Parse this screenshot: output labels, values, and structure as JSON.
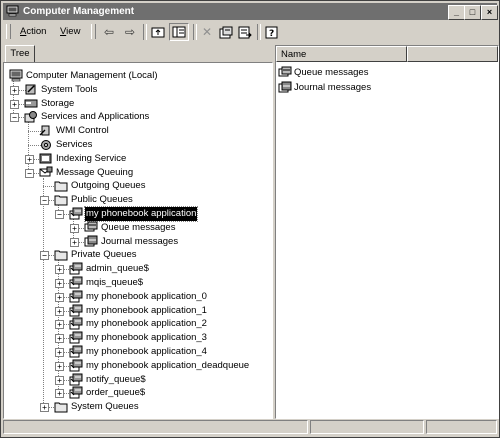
{
  "window": {
    "title": "Computer Management"
  },
  "titlebar_buttons": {
    "minimize": "_",
    "maximize": "□",
    "close": "×"
  },
  "menu": {
    "action": "Action",
    "view": "View"
  },
  "toolbar_icons": [
    "back-icon",
    "forward-icon",
    "up-folder-icon",
    "show-tree-icon",
    "delete-icon",
    "properties-icon",
    "export-icon",
    "help-icon"
  ],
  "tree_tab": "Tree",
  "list_header": {
    "name": "Name"
  },
  "tree": [
    {
      "label": "Computer Management (Local)",
      "icon": "computer-icon",
      "level": 0,
      "expander": "",
      "selected": false
    },
    {
      "label": "System Tools",
      "icon": "tools-icon",
      "level": 1,
      "expander": "+",
      "selected": false
    },
    {
      "label": "Storage",
      "icon": "storage-icon",
      "level": 1,
      "expander": "+",
      "selected": false
    },
    {
      "label": "Services and Applications",
      "icon": "services-apps-icon",
      "level": 1,
      "expander": "-",
      "selected": false
    },
    {
      "label": "WMI Control",
      "icon": "wmi-icon",
      "level": 2,
      "expander": "",
      "selected": false
    },
    {
      "label": "Services",
      "icon": "services-icon",
      "level": 2,
      "expander": "",
      "selected": false
    },
    {
      "label": "Indexing Service",
      "icon": "indexing-icon",
      "level": 2,
      "expander": "+",
      "selected": false
    },
    {
      "label": "Message Queuing",
      "icon": "message-queuing-icon",
      "level": 2,
      "expander": "-",
      "selected": false
    },
    {
      "label": "Outgoing Queues",
      "icon": "folder-icon",
      "level": 3,
      "expander": "",
      "selected": false
    },
    {
      "label": "Public Queues",
      "icon": "folder-icon",
      "level": 3,
      "expander": "-",
      "selected": false
    },
    {
      "label": "my phonebook application",
      "icon": "queue-icon",
      "level": 4,
      "expander": "-",
      "selected": true
    },
    {
      "label": "Queue messages",
      "icon": "queue-messages-icon",
      "level": 5,
      "expander": "+",
      "selected": false
    },
    {
      "label": "Journal messages",
      "icon": "journal-messages-icon",
      "level": 5,
      "expander": "+",
      "selected": false
    },
    {
      "label": "Private Queues",
      "icon": "folder-icon",
      "level": 3,
      "expander": "-",
      "selected": false
    },
    {
      "label": "admin_queue$",
      "icon": "queue-icon",
      "level": 4,
      "expander": "+",
      "selected": false
    },
    {
      "label": "mqis_queue$",
      "icon": "queue-icon",
      "level": 4,
      "expander": "+",
      "selected": false
    },
    {
      "label": "my phonebook application_0",
      "icon": "queue-icon",
      "level": 4,
      "expander": "+",
      "selected": false
    },
    {
      "label": "my phonebook application_1",
      "icon": "queue-icon",
      "level": 4,
      "expander": "+",
      "selected": false
    },
    {
      "label": "my phonebook application_2",
      "icon": "queue-icon",
      "level": 4,
      "expander": "+",
      "selected": false
    },
    {
      "label": "my phonebook application_3",
      "icon": "queue-icon",
      "level": 4,
      "expander": "+",
      "selected": false
    },
    {
      "label": "my phonebook application_4",
      "icon": "queue-icon",
      "level": 4,
      "expander": "+",
      "selected": false
    },
    {
      "label": "my phonebook application_deadqueue",
      "icon": "queue-icon",
      "level": 4,
      "expander": "+",
      "selected": false
    },
    {
      "label": "notify_queue$",
      "icon": "queue-icon",
      "level": 4,
      "expander": "+",
      "selected": false
    },
    {
      "label": "order_queue$",
      "icon": "queue-icon",
      "level": 4,
      "expander": "+",
      "selected": false
    },
    {
      "label": "System Queues",
      "icon": "folder-icon",
      "level": 3,
      "expander": "+",
      "selected": false
    }
  ],
  "list_items": [
    {
      "label": "Queue messages",
      "icon": "queue-messages-icon"
    },
    {
      "label": "Journal messages",
      "icon": "journal-messages-icon"
    }
  ]
}
